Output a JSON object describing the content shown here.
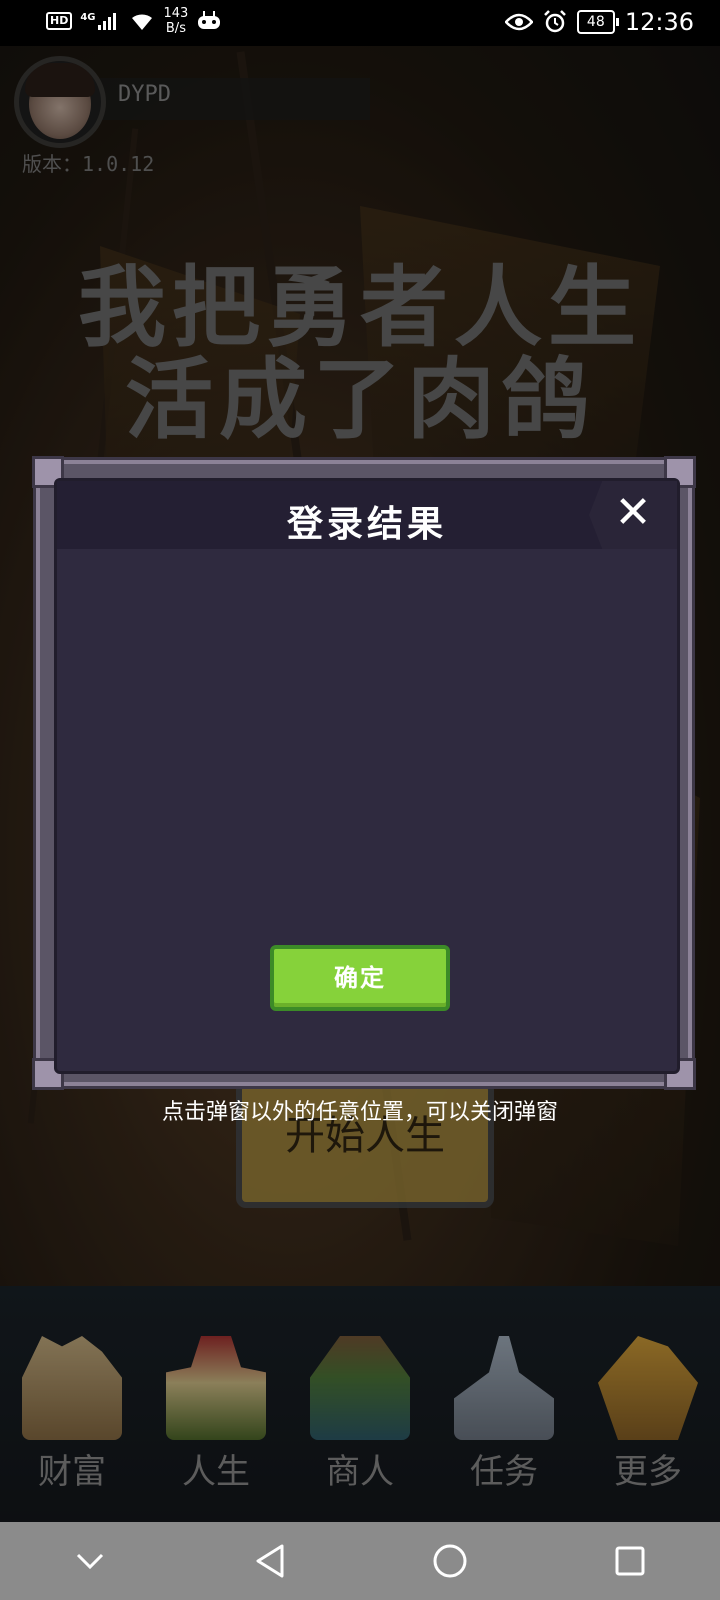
{
  "status_bar": {
    "hd": "HD",
    "network": "4G",
    "speed_value": "143",
    "speed_unit": "B/s",
    "battery": "48",
    "time": "12:36"
  },
  "profile": {
    "name": "DYPD",
    "version": "版本：1.0.12"
  },
  "title": {
    "line1": "我把勇者人生",
    "line2": "活成了肉鸽"
  },
  "start_button": "开始人生",
  "dialog": {
    "title": "登录结果",
    "close_symbol": "✕",
    "confirm_label": "确定"
  },
  "hint": "点击弹窗以外的任意位置，可以关闭弹窗",
  "bottom_nav": [
    {
      "label": "财富",
      "icon": "castle-icon"
    },
    {
      "label": "人生",
      "icon": "tower-icon"
    },
    {
      "label": "商人",
      "icon": "merchant-icon"
    },
    {
      "label": "任务",
      "icon": "quest-icon"
    },
    {
      "label": "更多",
      "icon": "more-icon"
    }
  ],
  "system_nav": [
    "chevron-down-icon",
    "back-icon",
    "home-icon",
    "recents-icon"
  ]
}
